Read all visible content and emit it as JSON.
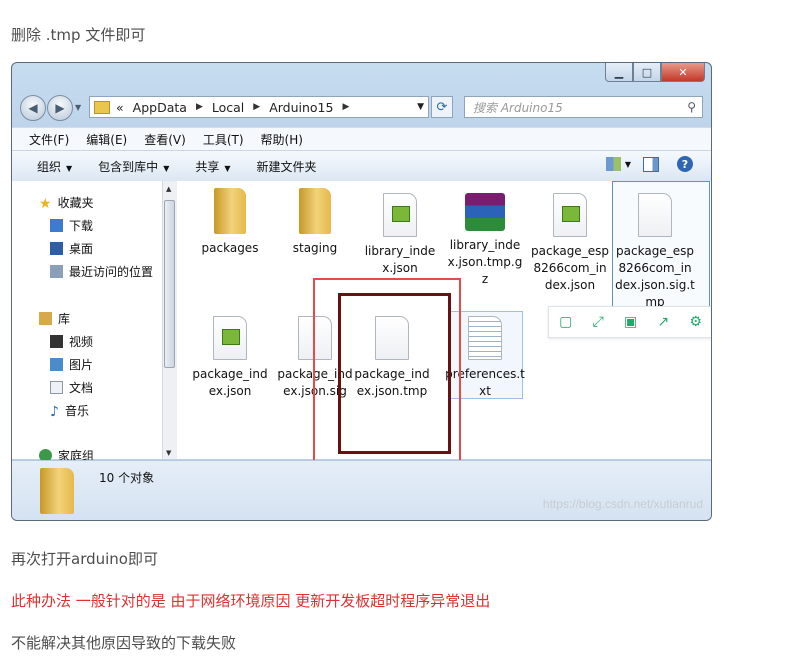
{
  "intro_text": "删除 .tmp 文件即可",
  "after_text": "再次打开arduino即可",
  "red_note": "此种办法 一般针对的是 由于网络环境原因 更新开发板超时程序异常退出",
  "last_text": "不能解决其他原因导致的下载失败",
  "window": {
    "controls": {
      "minimize": "▁",
      "maximize": "□",
      "close": "✕"
    },
    "address": {
      "chevron": "«",
      "segments": [
        "AppData",
        "Local",
        "Arduino15"
      ]
    },
    "search_placeholder": "搜索 Arduino15",
    "menu": [
      "文件(F)",
      "编辑(E)",
      "查看(V)",
      "工具(T)",
      "帮助(H)"
    ],
    "toolbar": [
      "组织",
      "包含到库中",
      "共享",
      "新建文件夹"
    ],
    "nav": [
      {
        "label": "收藏夹"
      },
      {
        "label": "下载"
      },
      {
        "label": "桌面"
      },
      {
        "label": "最近访问的位置"
      },
      {
        "label": "库"
      },
      {
        "label": "视频"
      },
      {
        "label": "图片"
      },
      {
        "label": "文档"
      },
      {
        "label": "音乐"
      },
      {
        "label": "家庭组"
      }
    ],
    "files": [
      {
        "name": "packages"
      },
      {
        "name": "staging"
      },
      {
        "name": "library_index.json"
      },
      {
        "name": "library_index.json.tmp.gz"
      },
      {
        "name": "package_esp8266com_index.json"
      },
      {
        "name": "package_esp8266com_index.json.sig.tmp"
      },
      {
        "name": "package_index.json"
      },
      {
        "name": "package_index.json.sig"
      },
      {
        "name": "package_index.json.tmp"
      },
      {
        "name": "preferences.txt"
      }
    ],
    "status_count": "10 个对象",
    "watermark": "https://blog.csdn.net/xutianrud"
  }
}
